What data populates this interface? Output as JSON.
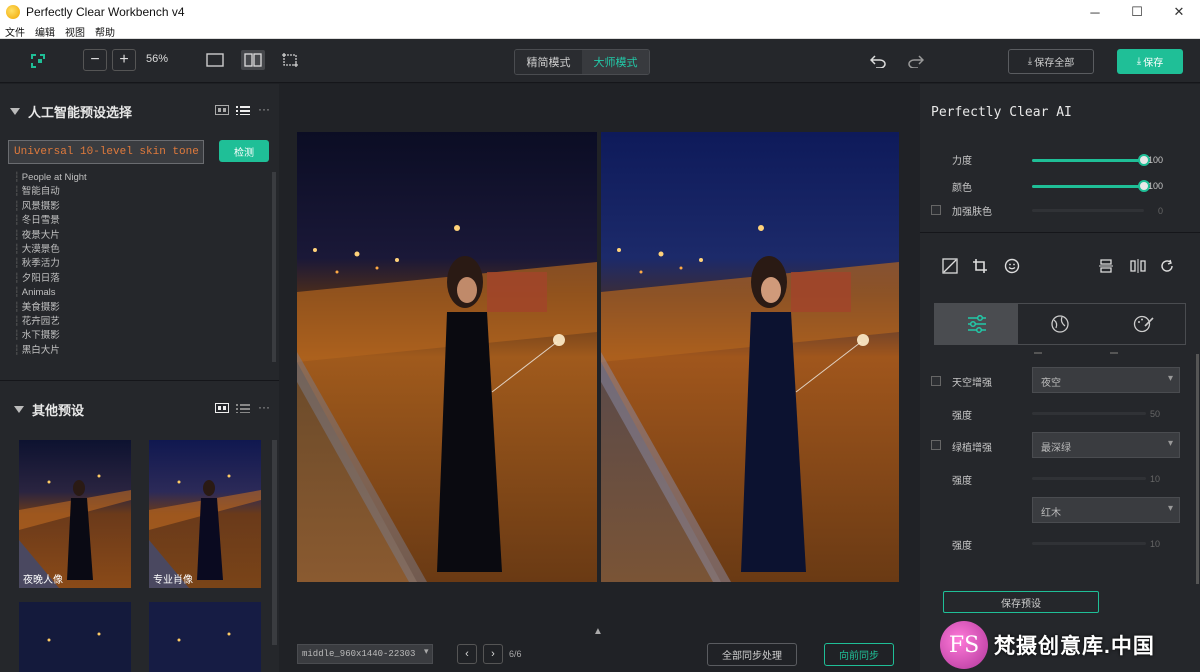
{
  "window": {
    "title": "Perfectly Clear Workbench v4",
    "controls": [
      "─",
      "☐",
      "✕"
    ]
  },
  "menu": [
    "文件",
    "编辑",
    "视图",
    "帮助"
  ],
  "toolbar": {
    "zoom_out": "−",
    "zoom_in": "+",
    "zoom_level": "56%",
    "mode_simple": "精简模式",
    "mode_master": "大师模式",
    "save_all": "保存全部",
    "save": "保存"
  },
  "left_panel": {
    "ai_section_title": "人工智能预设选择",
    "search_value": "Universal 10-level skin tone",
    "detect_label": "检测",
    "tree_items": [
      "People at Night",
      "智能自动",
      "风景摄影",
      "冬日雪景",
      "夜景大片",
      "大漠景色",
      "秋季活力",
      "夕阳日落",
      "Animals",
      "美食摄影",
      "花卉园艺",
      "水下摄影",
      "黑白大片"
    ],
    "other_section_title": "其他预设",
    "thumbnails": [
      {
        "caption": "夜晚人像"
      },
      {
        "caption": "专业肖像"
      },
      {
        "caption": ""
      },
      {
        "caption": ""
      }
    ]
  },
  "center": {
    "filename": "middle_960x1440-22303",
    "page_counter": "6/6",
    "sync_all": "全部同步处理",
    "sync_forward": "向前同步"
  },
  "right_panel": {
    "title": "Perfectly Clear AI",
    "strength_label": "力度",
    "strength_value": "100",
    "strength_level": 1.0,
    "color_label": "颜色",
    "color_value": "100",
    "color_level": 1.0,
    "skin_label": "加强肤色",
    "skin_value": "0",
    "sky_label": "天空增强",
    "sky_option": "夜空",
    "sky_strength_label": "强度",
    "sky_strength_value": "50",
    "green_label": "绿植增强",
    "green_option": "最深绿",
    "green_strength_label": "强度",
    "green_strength_value": "10",
    "wood_option": "红木",
    "wood_strength_label": "强度",
    "wood_strength_value": "10",
    "save_preset": "保存预设"
  },
  "watermark": {
    "logo_text": "FS",
    "text": "梵摄创意库.中国"
  },
  "colors": {
    "accent": "#1fbf97",
    "panel": "#25272b",
    "canvas": "#202226"
  }
}
